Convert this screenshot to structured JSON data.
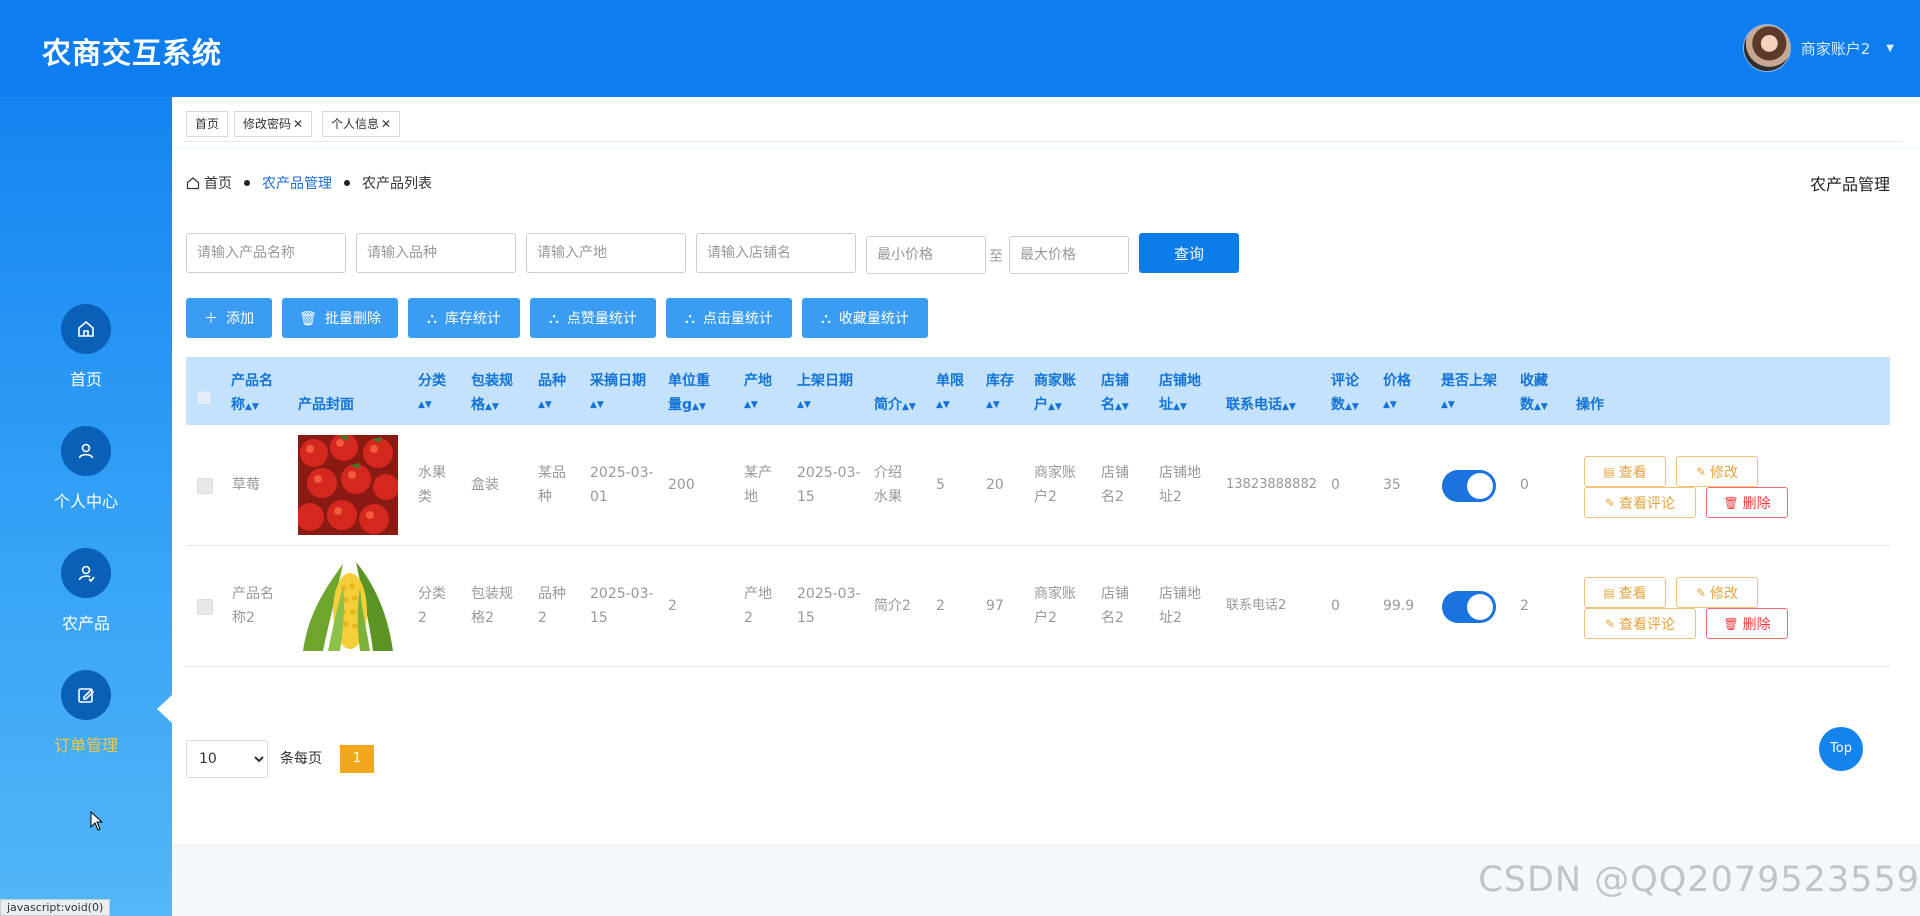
{
  "app": {
    "title": "农商交互系统"
  },
  "user": {
    "name": "商家账户2"
  },
  "sidebar": {
    "items": [
      {
        "label": "首页",
        "icon": "home-icon"
      },
      {
        "label": "个人中心",
        "icon": "user-icon"
      },
      {
        "label": "农产品",
        "icon": "product-user-icon"
      },
      {
        "label": "订单管理",
        "icon": "edit-icon",
        "active": true
      }
    ]
  },
  "tabs": [
    {
      "label": "首页"
    },
    {
      "label": "修改密码",
      "close": "✕"
    },
    {
      "label": "个人信息",
      "close": "✕"
    }
  ],
  "breadcrumb": {
    "home": "首页",
    "section": "农产品管理",
    "current": "农产品列表"
  },
  "page_heading": "农产品管理",
  "search": {
    "name_placeholder": "请输入产品名称",
    "variety_placeholder": "请输入品种",
    "origin_placeholder": "请输入产地",
    "shop_placeholder": "请输入店铺名",
    "min_price_placeholder": "最小价格",
    "to_label": "至",
    "max_price_placeholder": "最大价格",
    "query_label": "查询"
  },
  "actions": {
    "add": "添加",
    "batch_delete": "批量删除",
    "stock_stats": "库存统计",
    "like_stats": "点赞量统计",
    "click_stats": "点击量统计",
    "fav_stats": "收藏量统计"
  },
  "table": {
    "headers": {
      "name": [
        "产品名",
        "称"
      ],
      "cover": "产品封面",
      "category": [
        "分类"
      ],
      "package": [
        "包装规",
        "格"
      ],
      "variety": [
        "品种"
      ],
      "pick_date": [
        "采摘日期"
      ],
      "unit_weight": [
        "单位重",
        "量g"
      ],
      "origin": [
        "产地"
      ],
      "shelf_date": [
        "上架日期"
      ],
      "intro": "简介",
      "limit": [
        "单限"
      ],
      "stock": [
        "库存"
      ],
      "merchant": [
        "商家账",
        "户"
      ],
      "shop": [
        "店铺",
        "名"
      ],
      "shop_addr": [
        "店铺地",
        "址"
      ],
      "phone": "联系电话",
      "comments": [
        "评论",
        "数"
      ],
      "price": [
        "价格"
      ],
      "on_shelf": [
        "是否上架"
      ],
      "favorites": [
        "收藏",
        "数"
      ],
      "ops": "操作"
    },
    "rows": [
      {
        "name": [
          "草莓"
        ],
        "cover": "strawberry",
        "category": [
          "水果",
          "类"
        ],
        "package": [
          "盒装"
        ],
        "variety": [
          "某品",
          "种"
        ],
        "pick_date": [
          "2025-03-",
          "01"
        ],
        "unit_weight": "200",
        "origin": [
          "某产",
          "地"
        ],
        "shelf_date": [
          "2025-03-",
          "15"
        ],
        "intro": [
          "介绍",
          "水果"
        ],
        "limit": "5",
        "stock": "20",
        "merchant": [
          "商家账",
          "户2"
        ],
        "shop": [
          "店铺",
          "名2"
        ],
        "shop_addr": [
          "店铺地",
          "址2"
        ],
        "phone": "13823888882",
        "comments": "0",
        "price": "35",
        "favorites": "0",
        "on_shelf": true
      },
      {
        "name": [
          "产品名",
          "称2"
        ],
        "cover": "corn",
        "category": [
          "分类",
          "2"
        ],
        "package": [
          "包装规",
          "格2"
        ],
        "variety": [
          "品种",
          "2"
        ],
        "pick_date": [
          "2025-03-",
          "15"
        ],
        "unit_weight": "2",
        "origin": [
          "产地",
          "2"
        ],
        "shelf_date": [
          "2025-03-",
          "15"
        ],
        "intro": [
          "简介2"
        ],
        "limit": "2",
        "stock": "97",
        "merchant": [
          "商家账",
          "户2"
        ],
        "shop": [
          "店铺",
          "名2"
        ],
        "shop_addr": [
          "店铺地",
          "址2"
        ],
        "phone": "联系电话2",
        "comments": "0",
        "price": "99.9",
        "favorites": "2",
        "on_shelf": true
      }
    ],
    "op_labels": {
      "view": "查看",
      "edit": "修改",
      "view_comments": "查看评论",
      "delete": "删除"
    }
  },
  "pagination": {
    "page_size": "10",
    "per_page_label": "条每页",
    "current_page": "1"
  },
  "top_button": "Top",
  "watermark": "CSDN @QQ2079523559",
  "status_bar": "javascript:void(0)",
  "colors": {
    "header": "#0d7df0",
    "accent": "#0b7ce8",
    "active_nav": "#f5c542",
    "page_active": "#f1a81e",
    "toggle_on": "#1a73de"
  }
}
